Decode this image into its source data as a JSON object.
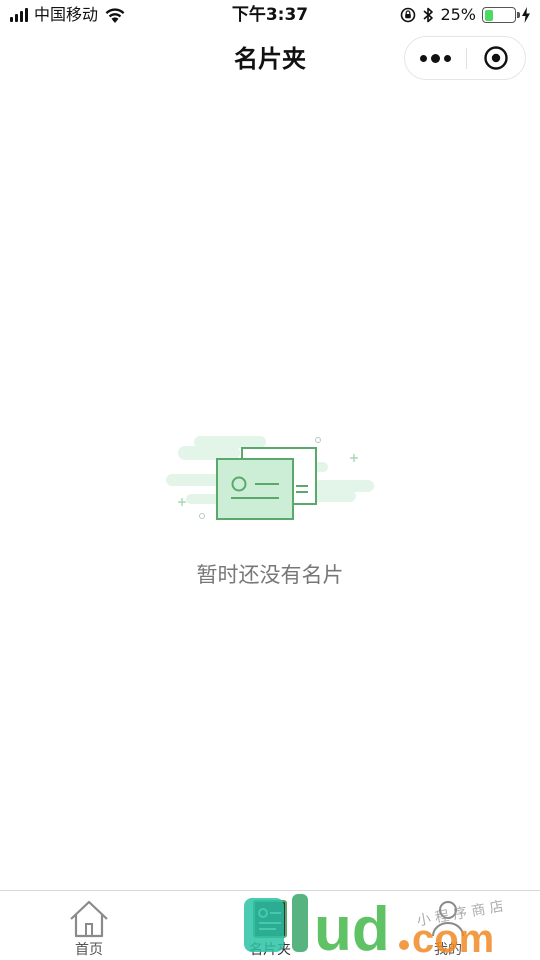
{
  "status_bar": {
    "carrier": "中国移动",
    "time": "下午3:37",
    "battery_percent": "25%",
    "battery_level": 0.25,
    "icons": [
      "signal-icon",
      "wifi-icon",
      "rotation-lock-icon",
      "bluetooth-icon",
      "battery-icon",
      "charging-icon"
    ]
  },
  "nav": {
    "title": "名片夹",
    "more_icon": "more-dots-icon",
    "close_icon": "target-close-icon"
  },
  "empty_state": {
    "icon": "business-cards-illustration",
    "message": "暂时还没有名片"
  },
  "tabs": [
    {
      "label": "首页",
      "icon": "home-icon"
    },
    {
      "label": "名片夹",
      "icon": "card-holder-icon",
      "active": true
    },
    {
      "label": "我的",
      "icon": "profile-icon"
    }
  ],
  "watermark": {
    "brand": "ud.com",
    "tagline": "小程序商店"
  },
  "colors": {
    "accent_green": "#5aa86c",
    "light_green": "#cdeed6",
    "battery_green": "#4cd964",
    "text_gray": "#777777"
  }
}
